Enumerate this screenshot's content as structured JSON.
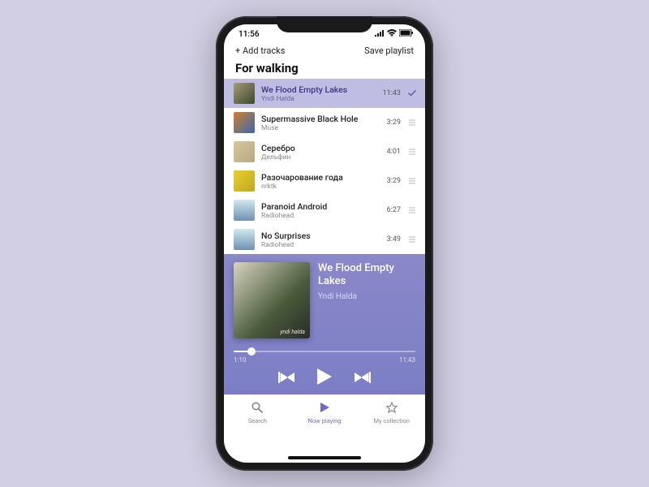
{
  "status": {
    "time": "11:56"
  },
  "topbar": {
    "add": "+ Add tracks",
    "save": "Save playlist"
  },
  "playlist_title": "For walking",
  "tracks": [
    {
      "title": "We Flood Empty Lakes",
      "artist": "Yndi Halda",
      "duration": "11:43",
      "art": "linear-gradient(135deg,#a89878,#3a4a2a)",
      "active": true
    },
    {
      "title": "Supermassive Black Hole",
      "artist": "Muse",
      "duration": "3:29",
      "art": "linear-gradient(135deg,#d08030,#3868b0)"
    },
    {
      "title": "Серебро",
      "artist": "Дельфин",
      "duration": "4:01",
      "art": "linear-gradient(135deg,#d8c8a0,#b8a880)"
    },
    {
      "title": "Разочарование года",
      "artist": "nrktk",
      "duration": "3:29",
      "art": "linear-gradient(135deg,#e8d030,#c0a820)"
    },
    {
      "title": "Paranoid Android",
      "artist": "Radiohead",
      "duration": "6:27",
      "art": "linear-gradient(180deg,#d0e8f0,#7090b0)"
    },
    {
      "title": "No Surprises",
      "artist": "Radiohead",
      "duration": "3:49",
      "art": "linear-gradient(180deg,#d0e8f0,#7090b0)"
    }
  ],
  "player": {
    "title": "We Flood Empty Lakes",
    "artist": "Yndi Halda",
    "elapsed": "1:10",
    "total": "11:43"
  },
  "tabs": {
    "search": "Search",
    "now": "Now playing",
    "collection": "My collection"
  }
}
